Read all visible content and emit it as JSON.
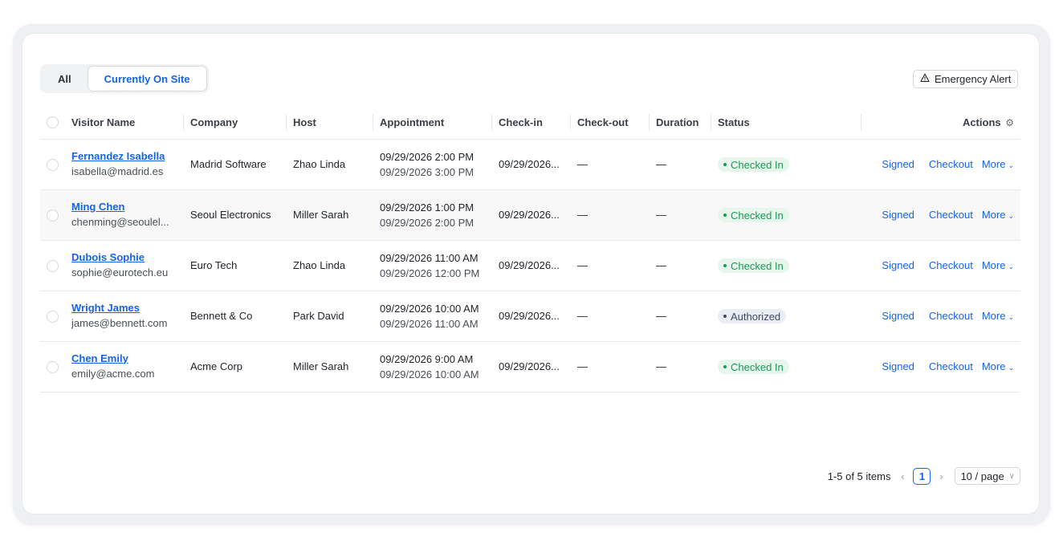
{
  "tabs": [
    {
      "label": "All",
      "active": false
    },
    {
      "label": "Currently On Site",
      "active": true
    }
  ],
  "emergency": {
    "icon": "warning-triangle-icon",
    "label": "Emergency Alert"
  },
  "columns": {
    "visitor": "Visitor Name",
    "company": "Company",
    "host": "Host",
    "appointment": "Appointment",
    "checkin": "Check-in",
    "checkout": "Check-out",
    "duration": "Duration",
    "status": "Status",
    "actions": "Actions"
  },
  "rows": [
    {
      "name": "Fernandez Isabella",
      "email": "isabella@madrid.es",
      "company": "Madrid Software",
      "host": "Zhao Linda",
      "appt_start": "09/29/2026 2:00 PM",
      "appt_end": "09/29/2026 3:00 PM",
      "checkin": "09/29/2026...",
      "checkout": "—",
      "duration": "—",
      "status": "Checked In",
      "signed": "Signed",
      "checkout_action": "Checkout",
      "more": "More"
    },
    {
      "name": "Ming Chen",
      "email": "chenming@seoulel...",
      "company": "Seoul Electronics",
      "host": "Miller Sarah",
      "appt_start": "09/29/2026 1:00 PM",
      "appt_end": "09/29/2026 2:00 PM",
      "checkin": "09/29/2026...",
      "checkout": "—",
      "duration": "—",
      "status": "Checked In",
      "signed": "Signed",
      "checkout_action": "Checkout",
      "more": "More"
    },
    {
      "name": "Dubois Sophie",
      "email": "sophie@eurotech.eu",
      "company": "Euro Tech",
      "host": "Zhao Linda",
      "appt_start": "09/29/2026 11:00 AM",
      "appt_end": "09/29/2026 12:00 PM",
      "checkin": "09/29/2026...",
      "checkout": "—",
      "duration": "—",
      "status": "Checked In",
      "signed": "Signed",
      "checkout_action": "Checkout",
      "more": "More"
    },
    {
      "name": "Wright James",
      "email": "james@bennett.com",
      "company": "Bennett & Co",
      "host": "Park David",
      "appt_start": "09/29/2026 10:00 AM",
      "appt_end": "09/29/2026 11:00 AM",
      "checkin": "09/29/2026...",
      "checkout": "—",
      "duration": "—",
      "status": "Authorized",
      "signed": "Signed",
      "checkout_action": "Checkout",
      "more": "More"
    },
    {
      "name": "Chen Emily",
      "email": "emily@acme.com",
      "company": "Acme Corp",
      "host": "Miller Sarah",
      "appt_start": "09/29/2026 9:00 AM",
      "appt_end": "09/29/2026 10:00 AM",
      "checkin": "09/29/2026...",
      "checkout": "—",
      "duration": "—",
      "status": "Checked In",
      "signed": "Signed",
      "checkout_action": "Checkout",
      "more": "More"
    }
  ],
  "status_colors": {
    "Checked In": "#1a9a55",
    "Authorized": "#3d4c63"
  },
  "accent": "#1664e6",
  "pagination": {
    "summary": "1-5 of 5 items",
    "current_page": "1",
    "page_size": "10 / page"
  }
}
